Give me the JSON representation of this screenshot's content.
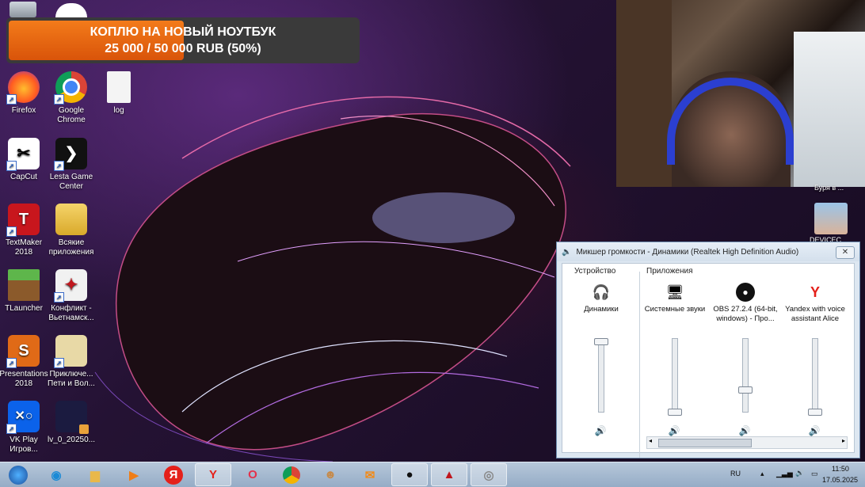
{
  "donation": {
    "title": "КОПЛЮ НА НОВЫЙ НОУТБУК",
    "progress_text": "25 000 / 50 000 RUB (50%)",
    "progress_fraction": 0.5
  },
  "desktop_icons": [
    {
      "label": "Firefox",
      "icon": "firefox-icon"
    },
    {
      "label": "Google Chrome",
      "icon": "chrome-icon"
    },
    {
      "label": "log",
      "icon": "document-icon"
    },
    {
      "label": "CapCut",
      "icon": "capcut-icon"
    },
    {
      "label": "Lesta Game Center",
      "icon": "lesta-icon"
    },
    {
      "label": "TextMaker 2018",
      "icon": "textmaker-icon"
    },
    {
      "label": "Всякие приложения",
      "icon": "folder-icon"
    },
    {
      "label": "TLauncher",
      "icon": "minecraft-icon"
    },
    {
      "label": "Конфликт - Вьетнамск...",
      "icon": "game-icon"
    },
    {
      "label": "Presentations 2018",
      "icon": "presentations-icon"
    },
    {
      "label": "Приключе... Пети и Вол...",
      "icon": "game-icon"
    },
    {
      "label": "VK Play Игров...",
      "icon": "vkplay-icon"
    },
    {
      "label": "lv_0_20250...",
      "icon": "video-icon"
    }
  ],
  "right_edge": {
    "partial_label": "Буря в ...",
    "partial_label2": "DEVICEC..."
  },
  "mixer": {
    "title": "Микшер громкости - Динамики (Realtek High Definition Audio)",
    "device_group": "Устройство",
    "apps_group": "Приложения",
    "channels": [
      {
        "name": "Динамики",
        "icon": "headset-icon",
        "level": 1.0
      },
      {
        "name": "Системные звуки",
        "icon": "monitor-speaker-icon",
        "level": 0.0
      },
      {
        "name": "OBS 27.2.4 (64-bit, windows) - Про...",
        "icon": "obs-icon",
        "level": 0.3
      },
      {
        "name": "Yandex with voice assistant Alice",
        "icon": "yandex-icon",
        "level": 0.0
      }
    ]
  },
  "taskbar": {
    "items": [
      "start-orb-icon",
      "edge-icon",
      "explorer-icon",
      "media-player-icon",
      "yandex-ya-icon",
      "yandex-browser-icon",
      "opera-icon",
      "chrome-icon",
      "game-icon",
      "mail-icon",
      "obs-icon",
      "lesta-icon",
      "audio-icon"
    ],
    "lang": "RU",
    "time": "11:50",
    "date": "17.05.2025"
  },
  "colors": {
    "accent_orange": "#e8650f",
    "taskbar": "#a7bbd1"
  }
}
